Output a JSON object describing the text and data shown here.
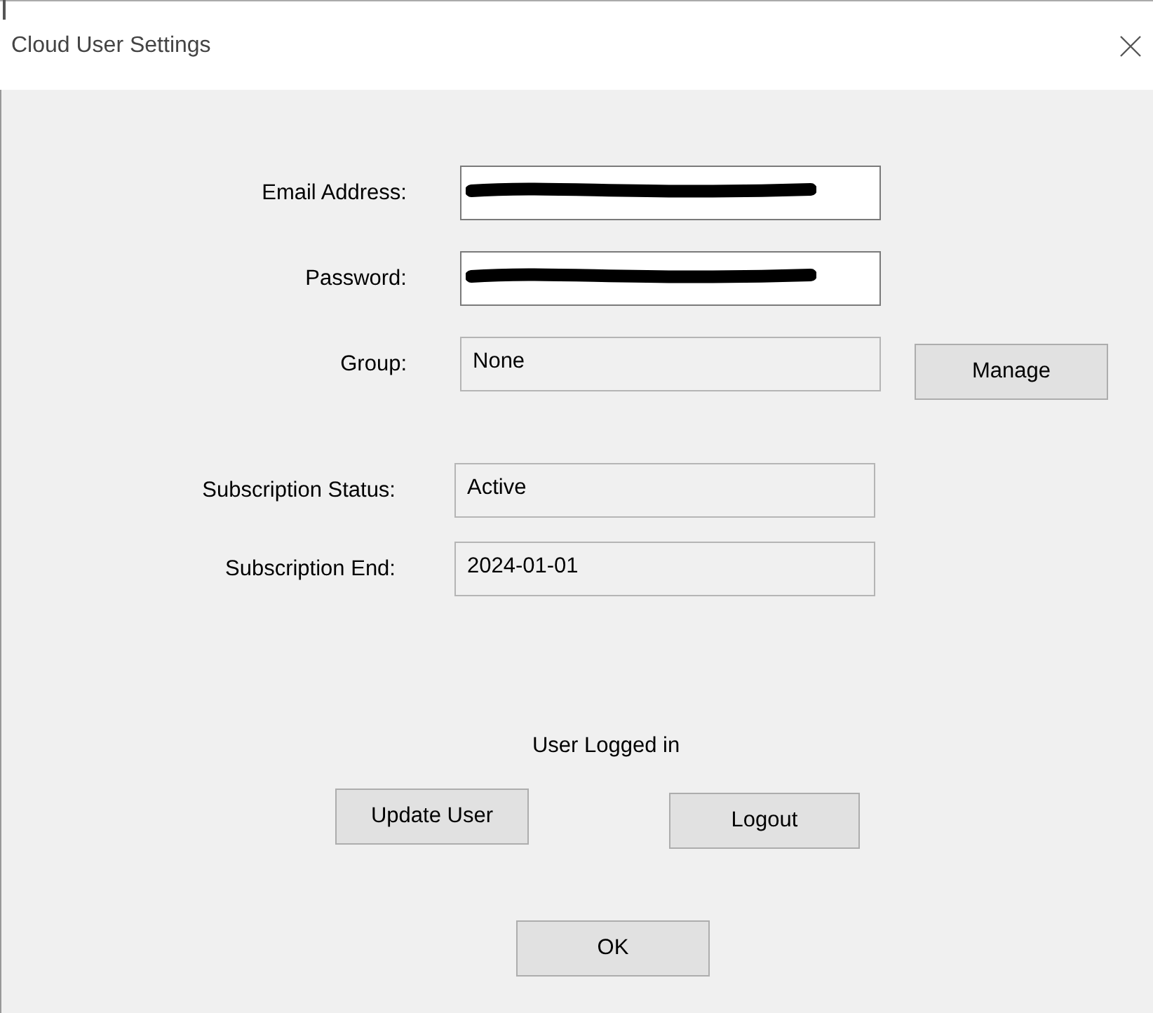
{
  "window": {
    "title": "Cloud User Settings"
  },
  "account_fields": [
    {
      "label": "Email Address:",
      "redacted": true,
      "disabled": false
    },
    {
      "label": "Password:",
      "redacted": true,
      "disabled": false
    },
    {
      "label": "Group:",
      "value": "None",
      "disabled": true
    }
  ],
  "manage_button": "Manage",
  "subscription_fields": [
    {
      "label": "Subscription Status:",
      "value": "Active",
      "disabled": true
    },
    {
      "label": "Subscription End:",
      "value": "2024-01-01",
      "disabled": true
    }
  ],
  "status_text": "User Logged in",
  "buttons": [
    "Update User",
    "Logout"
  ],
  "ok_button": "OK"
}
